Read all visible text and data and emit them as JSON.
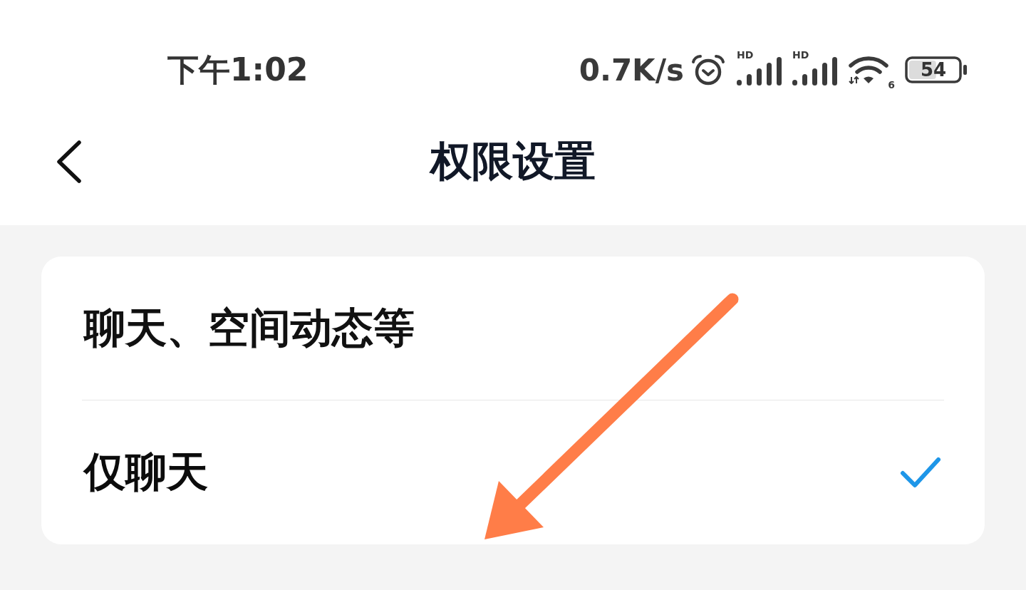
{
  "status_bar": {
    "time": "下午1:02",
    "net_speed": "0.7K/s",
    "signals": [
      {
        "label": "HD"
      },
      {
        "label": "HD"
      }
    ],
    "wifi": {
      "badge": "6"
    },
    "battery": {
      "text": "54"
    }
  },
  "nav": {
    "title": "权限设置"
  },
  "options": [
    {
      "label": "聊天、空间动态等",
      "selected": false
    },
    {
      "label": "仅聊天",
      "selected": true
    }
  ]
}
